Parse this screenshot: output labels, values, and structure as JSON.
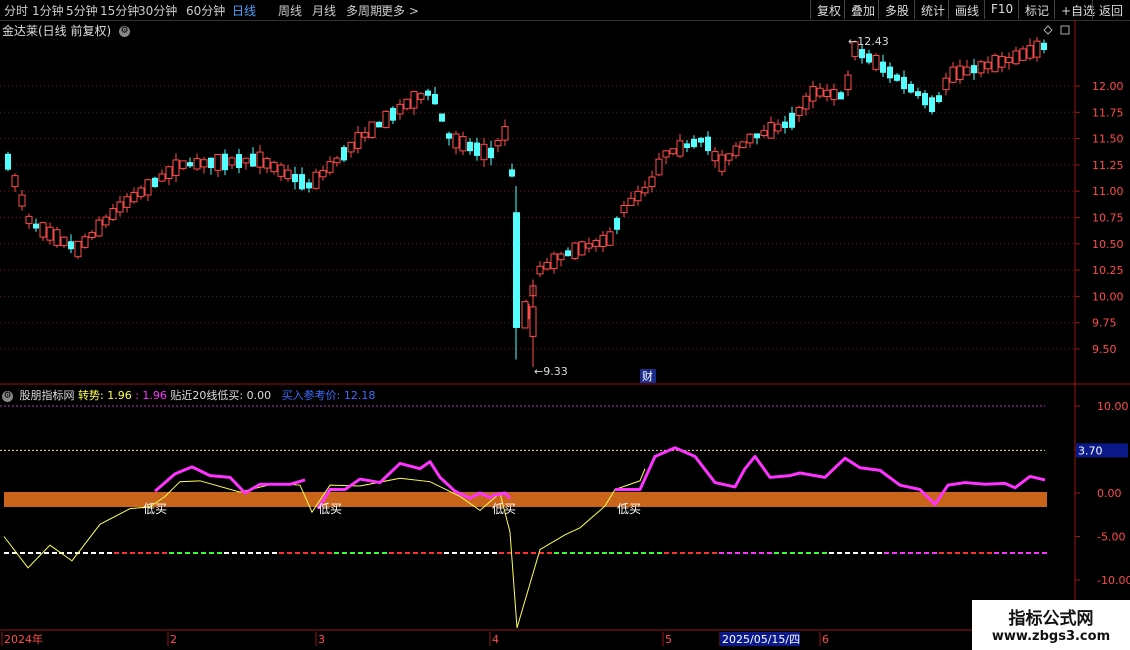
{
  "toolbar": {
    "periods": [
      "分时",
      "1分钟",
      "5分钟",
      "15分钟",
      "30分钟",
      "60分钟",
      "日线",
      "周线",
      "月线",
      "多周期",
      "更多 >"
    ],
    "active_period": "日线",
    "right_buttons": [
      "复权",
      "叠加",
      "多股",
      "统计",
      "画线",
      "F10",
      "标记",
      "+自选",
      "返回"
    ]
  },
  "stock": {
    "title": "金达莱(日线 前复权)"
  },
  "main_chart": {
    "price_ticks": [
      "12.00",
      "11.75",
      "11.50",
      "11.25",
      "11.00",
      "10.75",
      "10.50",
      "10.25",
      "10.00",
      "9.75",
      "9.50"
    ],
    "high_label": "12.43",
    "low_label": "9.33",
    "finance_marker": "财",
    "reset_icon": "diamond-icon",
    "expand_icon": "square-icon"
  },
  "indicator": {
    "name": "股朋指标网",
    "trend_label": "转势:",
    "trend_val1": "1.96",
    "trend_val2": "1.96",
    "ma20_label": "贴近20线低买:",
    "ma20_val": "0.00",
    "buy_label": "买入参考价:",
    "buy_val": "12.18",
    "y_ticks": [
      "10.00",
      "5.00",
      "0.00",
      "-5.00",
      "-10.00"
    ],
    "level_marker": "3.70",
    "buy_signals": [
      "低买",
      "低买",
      "低买",
      "低买"
    ]
  },
  "timeline": {
    "labels": [
      "2024年",
      "2",
      "3",
      "4",
      "5",
      "2025/05/15/四",
      "6"
    ]
  },
  "watermark": {
    "title": "指标公式网",
    "url": "www.zbgs3.com"
  },
  "colors": {
    "up": "#ff4b4b",
    "down": "#54ffff",
    "trend": "#ff33ff",
    "yellow": "#ffff55",
    "band": "#c8651b"
  }
}
